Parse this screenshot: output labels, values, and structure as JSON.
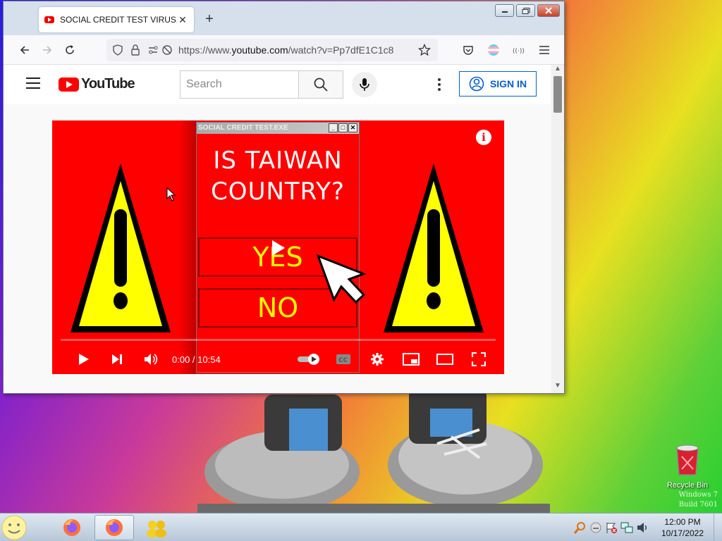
{
  "browser": {
    "tab_title": "SOCIAL CREDIT TEST VIRUS⚠!!!",
    "tab_close": "✕",
    "new_tab": "+",
    "url_prefix": "https://www.",
    "url_host": "youtube.com",
    "url_path": "/watch?v=Pp7dfE1C1c8"
  },
  "youtube": {
    "logo_text": "YouTube",
    "search_placeholder": "Search",
    "signin_label": "SIGN IN"
  },
  "video": {
    "popup_title": "SOCIAL CREDIT TEST.EXE",
    "question_line1": "IS TAIWAN",
    "question_line2": "COUNTRY?",
    "answer_yes": "YES",
    "answer_no": "NO",
    "time": "0:00 / 10:54",
    "info_glyph": "i",
    "progress_fraction": 0.0
  },
  "desktop": {
    "recycle_bin_label": "Recycle Bin",
    "watermark_line1": "Windows 7",
    "watermark_line2": "Build 7601"
  },
  "taskbar": {
    "clock_time": "12:00 PM",
    "clock_date": "10/17/2022"
  },
  "colors": {
    "youtube_red": "#ff0000",
    "signin_blue": "#065fd4",
    "warning_yellow": "#ffff00"
  }
}
